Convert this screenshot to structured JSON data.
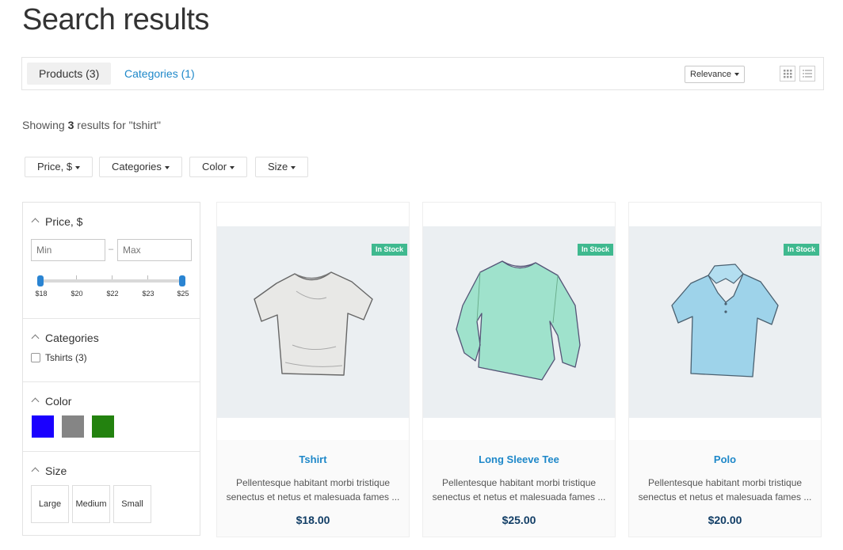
{
  "page": {
    "title": "Search results"
  },
  "tabs": [
    {
      "label": "Products (3)",
      "active": true
    },
    {
      "label": "Categories (1)",
      "active": false
    }
  ],
  "sort": {
    "selected": "Relevance"
  },
  "results": {
    "prefix": "Showing ",
    "count": "3",
    "suffix": " results for \"tshirt\""
  },
  "filter_buttons": [
    "Price, $",
    "Categories",
    "Color",
    "Size"
  ],
  "sidebar": {
    "price": {
      "title": "Price, $",
      "min_placeholder": "Min",
      "max_placeholder": "Max",
      "dash": "–",
      "ticks": [
        "$18",
        "$20",
        "$22",
        "$23",
        "$25"
      ]
    },
    "categories": {
      "title": "Categories",
      "items": [
        {
          "label": "Tshirts",
          "count": "(3)"
        }
      ]
    },
    "color": {
      "title": "Color",
      "swatches": [
        "#1a00ff",
        "#858585",
        "#23820f"
      ]
    },
    "size": {
      "title": "Size",
      "options": [
        "Large",
        "Medium",
        "Small"
      ]
    }
  },
  "products": [
    {
      "name": "Tshirt",
      "badge": "In Stock",
      "description": "Pellentesque habitant morbi tristique senectus et netus et malesuada fames ...",
      "price": "$18.00",
      "color": "#e8e8e6"
    },
    {
      "name": "Long Sleeve Tee",
      "badge": "In Stock",
      "description": "Pellentesque habitant morbi tristique senectus et netus et malesuada fames ...",
      "price": "$25.00",
      "color": "#9fe2cc"
    },
    {
      "name": "Polo",
      "badge": "In Stock",
      "description": "Pellentesque habitant morbi tristique senectus et netus et malesuada fames ...",
      "price": "$20.00",
      "color": "#9ed3ea"
    }
  ]
}
